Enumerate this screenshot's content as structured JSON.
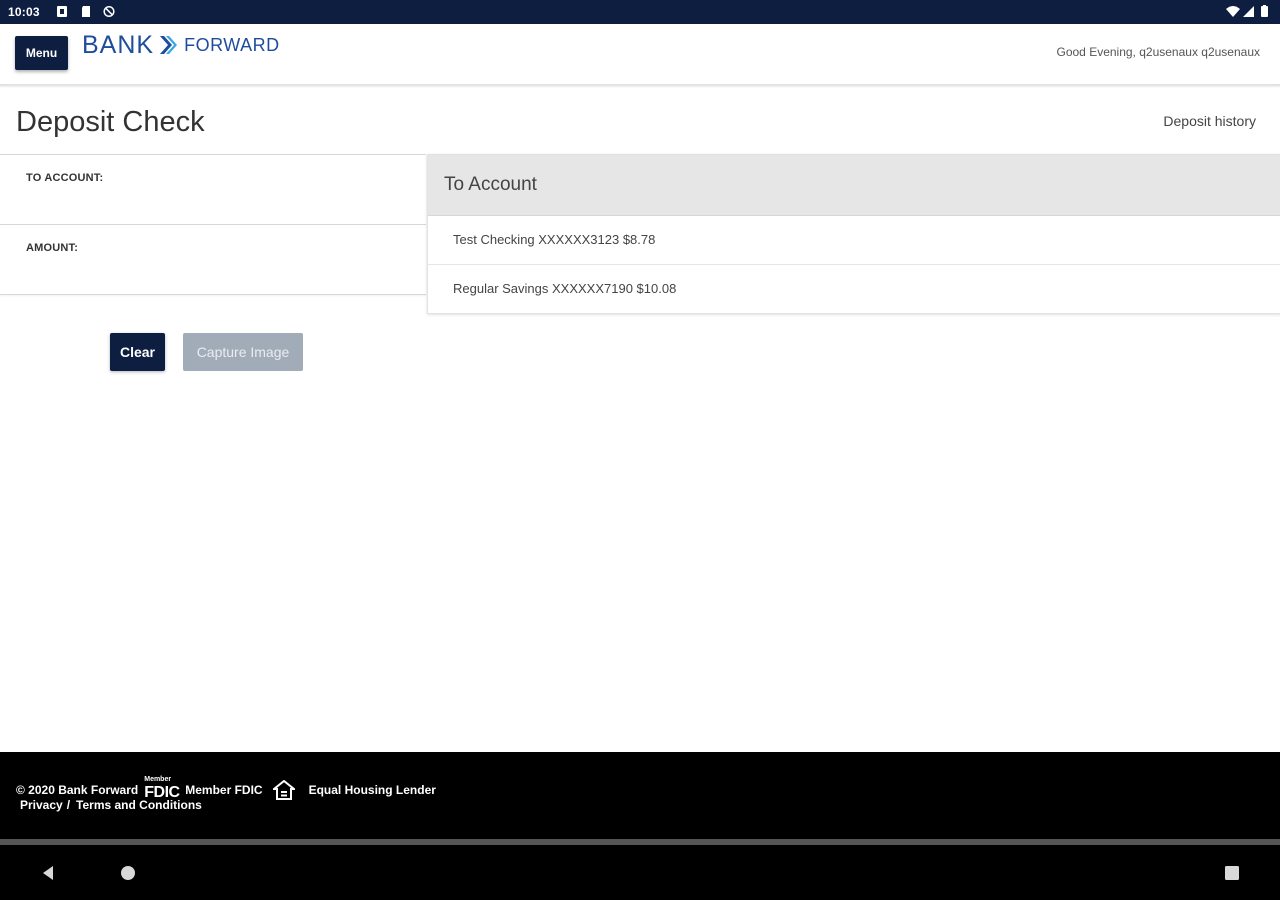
{
  "status_bar": {
    "time": "10:03"
  },
  "header": {
    "menu_label": "Menu",
    "logo_bank": "BANK",
    "logo_forward": "FORWARD",
    "greeting": "Good Evening, q2usenaux q2usenaux",
    "brand_color": "#0d1e40"
  },
  "page": {
    "title": "Deposit Check",
    "history_link": "Deposit history"
  },
  "form": {
    "to_account_label": "TO ACCOUNT:",
    "amount_label": "AMOUNT:",
    "clear_label": "Clear",
    "capture_label": "Capture Image"
  },
  "account_picker": {
    "heading": "To Account",
    "items": [
      {
        "label": "Test Checking XXXXXX3123 $8.78"
      },
      {
        "label": "Regular Savings XXXXXX7190 $10.08"
      }
    ]
  },
  "footer": {
    "copyright": "© 2020 Bank Forward",
    "fdic_small": "Member",
    "fdic_big": "FDIC",
    "member_fdic": "Member FDIC",
    "equal_housing": "Equal Housing Lender",
    "privacy": "Privacy",
    "separator": "/",
    "terms": "Terms and Conditions"
  },
  "icons": {
    "status_left": [
      "notification-icon",
      "sim-card-icon",
      "no-sync-icon"
    ],
    "status_right": [
      "wifi-icon",
      "signal-icon",
      "battery-icon"
    ],
    "nav": [
      "back-icon",
      "home-icon",
      "recents-icon"
    ]
  }
}
